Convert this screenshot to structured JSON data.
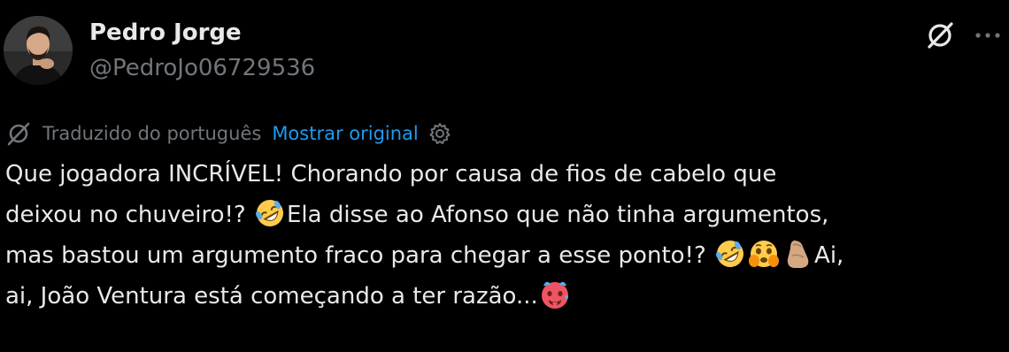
{
  "author": {
    "display_name": "Pedro Jorge",
    "handle": "@PedroJo06729536",
    "avatar_icon": "profile-photo-man-avatar"
  },
  "header": {
    "grok_icon": "grok-icon",
    "more_icon": "more-options-icon"
  },
  "translation": {
    "label": "Traduzido do português",
    "show_original_label": "Mostrar original",
    "translate_icon": "translate-icon",
    "settings_icon": "gear-icon"
  },
  "tweet": {
    "line1": "Que jogadora INCRÍVEL! Chorando por causa de fios de cabelo que",
    "line2_a": "deixou no chuveiro!? ",
    "line2_b": "Ela disse ao Afonso que não tinha argumentos,",
    "line3_a": "mas bastou um argumento fraco para chegar a esse ponto!? ",
    "line3_b": "Ai,",
    "line4_a": "ai, João Ventura está começando a ter razão...",
    "emojis": [
      "rolling-on-floor-laughing-emoji",
      "face-holding-back-tears-emoji",
      "pinched-fingers-emoji",
      "hot-face-emoji"
    ]
  },
  "colors": {
    "background": "#000000",
    "text": "#e7e9ea",
    "muted": "#71767b",
    "link": "#1d9bf0"
  }
}
